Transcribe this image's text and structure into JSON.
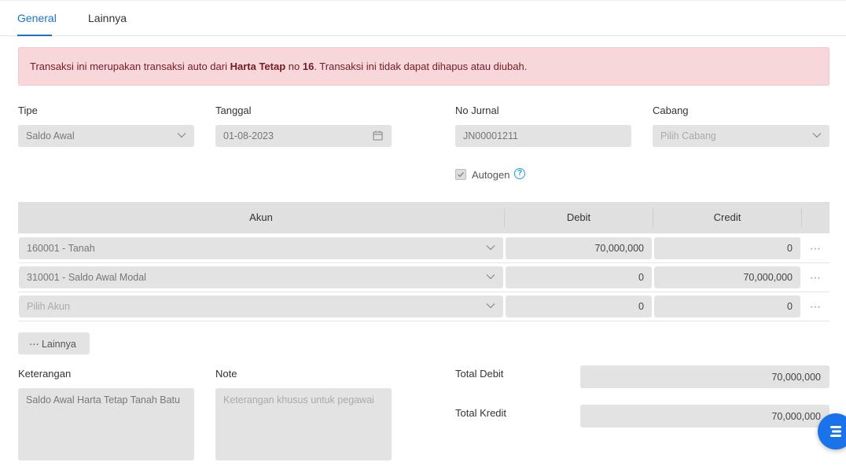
{
  "tabs": [
    {
      "label": "General",
      "active": true
    },
    {
      "label": "Lainnya",
      "active": false
    }
  ],
  "alert": {
    "prefix": "Transaksi ini merupakan transaksi auto dari ",
    "source": "Harta Tetap",
    "mid": " no ",
    "number": "16",
    "suffix": ". Transaksi ini tidak dapat dihapus atau diubah."
  },
  "form": {
    "tipe_label": "Tipe",
    "tipe_value": "Saldo Awal",
    "tanggal_label": "Tanggal",
    "tanggal_value": "01-08-2023",
    "no_jurnal_label": "No Jurnal",
    "no_jurnal_value": "JN00001211",
    "cabang_label": "Cabang",
    "cabang_placeholder": "Pilih Cabang",
    "autogen_label": "Autogen",
    "autogen_checked": true
  },
  "table": {
    "headers": {
      "akun": "Akun",
      "debit": "Debit",
      "credit": "Credit"
    },
    "rows": [
      {
        "akun": "160001 - Tanah",
        "debit": "70,000,000",
        "credit": "0"
      },
      {
        "akun": "310001 - Saldo Awal Modal",
        "debit": "0",
        "credit": "70,000,000"
      },
      {
        "akun": "Pilih Akun",
        "debit": "0",
        "credit": "0"
      }
    ],
    "more_button": "Lainnya"
  },
  "footer": {
    "keterangan_label": "Keterangan",
    "keterangan_value": "Saldo Awal Harta Tetap Tanah Batu",
    "note_label": "Note",
    "note_placeholder": "Keterangan khusus untuk pegawai",
    "total_debit_label": "Total Debit",
    "total_debit_value": "70,000,000",
    "total_kredit_label": "Total Kredit",
    "total_kredit_value": "70,000,000"
  },
  "colors": {
    "accent": "#1a73c8",
    "alert_bg": "#f8d7da",
    "alert_text": "#721c24",
    "field_bg": "#e3e3e3",
    "fab": "#1a73e8"
  }
}
